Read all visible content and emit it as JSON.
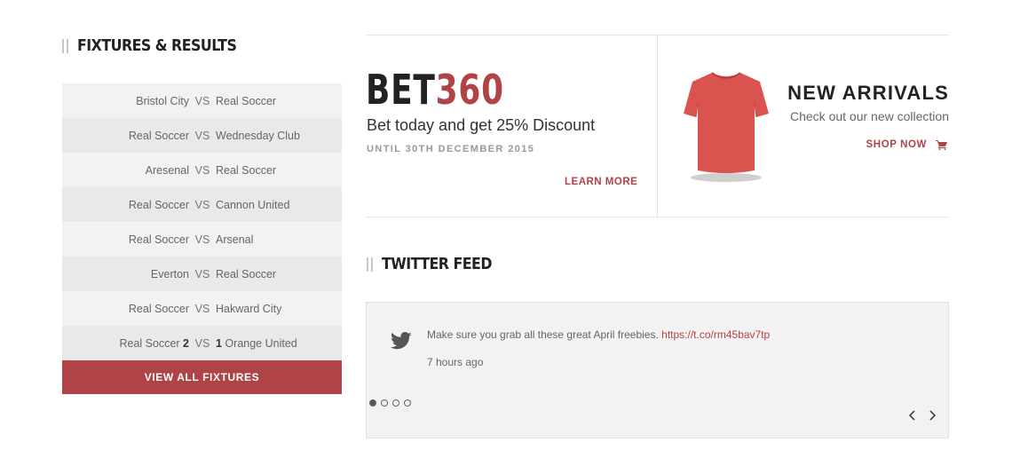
{
  "fixtures": {
    "title": "FIXTURES & RESULTS",
    "vs_label": "VS",
    "rows": [
      {
        "home": "Bristol City",
        "home_score": "",
        "away": "Real Soccer",
        "away_score": ""
      },
      {
        "home": "Real Soccer",
        "home_score": "",
        "away": "Wednesday Club",
        "away_score": ""
      },
      {
        "home": "Aresenal",
        "home_score": "",
        "away": "Real Soccer",
        "away_score": ""
      },
      {
        "home": "Real Soccer",
        "home_score": "",
        "away": "Cannon United",
        "away_score": ""
      },
      {
        "home": "Real Soccer",
        "home_score": "",
        "away": "Arsenal",
        "away_score": ""
      },
      {
        "home": "Everton",
        "home_score": "",
        "away": "Real Soccer",
        "away_score": ""
      },
      {
        "home": "Real Soccer",
        "home_score": "",
        "away": "Hakward City",
        "away_score": ""
      },
      {
        "home": "Real Soccer",
        "home_score": "2",
        "away": "Orange United",
        "away_score": "1"
      }
    ],
    "view_all_label": "VIEW ALL FIXTURES"
  },
  "bet_promo": {
    "logo_part1": "BET",
    "logo_part2": "360",
    "subtitle": "Bet today and get 25% Discount",
    "until": "UNTIL 30TH DECEMBER 2015",
    "learn_more": "LEARN MORE"
  },
  "new_arrivals": {
    "title": "NEW ARRIVALS",
    "subtitle": "Check out our new collection",
    "shop_now": "SHOP NOW",
    "product_icon": "tshirt-image",
    "cart_icon": "cart-icon"
  },
  "twitter": {
    "title": "TWITTER FEED",
    "tweet_text": "Make sure you grab all these great April freebies.",
    "tweet_link": "https://t.co/rm45bav7tp",
    "time": "7 hours ago",
    "slides": 4,
    "active_slide": 1
  },
  "colors": {
    "accent": "#b04345",
    "row_light": "#f2f2f2",
    "row_dark": "#e9e9e9",
    "shirt": "#d9534f"
  }
}
